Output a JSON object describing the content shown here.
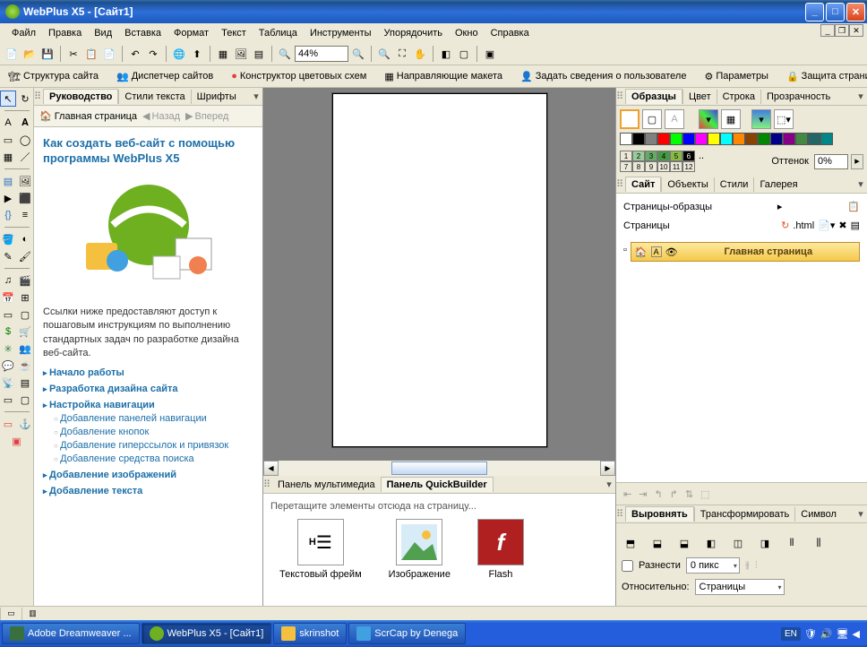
{
  "titlebar": {
    "title": "WebPlus X5 - [Сайт1]"
  },
  "menu": [
    "Файл",
    "Правка",
    "Вид",
    "Вставка",
    "Формат",
    "Текст",
    "Таблица",
    "Инструменты",
    "Упорядочить",
    "Окно",
    "Справка"
  ],
  "toolbar2": {
    "zoom": "44%",
    "items": [
      "Структура сайта",
      "Диспетчер сайтов",
      "Конструктор цветовых схем",
      "Направляющие макета",
      "Задать сведения о пользователе",
      "Параметры",
      "Защита страницы"
    ]
  },
  "guide": {
    "tabs": [
      "Руководство",
      "Стили текста",
      "Шрифты"
    ],
    "nav": {
      "home": "Главная страница",
      "back": "Назад",
      "fwd": "Вперед"
    },
    "heading": "Как создать веб-сайт с помощью программы WebPlus X5",
    "intro": "Ссылки ниже предоставляют доступ к пошаговым инструкциям по выполнению стандартных задач по разработке дизайна веб-сайта.",
    "links": [
      "Начало работы",
      "Разработка дизайна сайта",
      "Настройка навигации"
    ],
    "sublinks": [
      "Добавление панелей навигации",
      "Добавление кнопок",
      "Добавление гиперссылок и привязок",
      "Добавление средства поиска"
    ],
    "links2": [
      "Добавление изображений",
      "Добавление текста"
    ]
  },
  "qb": {
    "tabs": [
      "Панель мультимедиа",
      "Панель QuickBuilder"
    ],
    "hint": "Перетащите элементы отсюда на страницу...",
    "items": [
      "Текстовый фрейм",
      "Изображение",
      "Flash"
    ]
  },
  "right": {
    "swatch_tabs": [
      "Образцы",
      "Цвет",
      "Строка",
      "Прозрачность"
    ],
    "tint_label": "Оттенок",
    "tint_val": "0%",
    "colors": [
      "#ffffff",
      "#000000",
      "#808080",
      "#ff0000",
      "#00ff00",
      "#0000ff",
      "#ff00ff",
      "#ffff00",
      "#00ffff",
      "#ff8000",
      "#804000",
      "#008000",
      "#000080",
      "#800080",
      "#408040",
      "#206060",
      "#008080"
    ],
    "site_tabs": [
      "Сайт",
      "Объекты",
      "Стили",
      "Галерея"
    ],
    "site": {
      "templates_label": "Страницы-образцы",
      "pages_label": "Страницы",
      "ext": ".html",
      "page_name": "Главная страница"
    },
    "align_tabs": [
      "Выровнять",
      "Трансформировать",
      "Символ"
    ],
    "spread_label": "Разнести",
    "spread_val": "0 пикс",
    "rel_label": "Относительно:",
    "rel_val": "Страницы"
  },
  "taskbar": {
    "items": [
      "Adobe Dreamweaver ...",
      "WebPlus X5 - [Сайт1]",
      "skrinshot",
      "ScrCap by Denega"
    ],
    "lang": "EN"
  }
}
